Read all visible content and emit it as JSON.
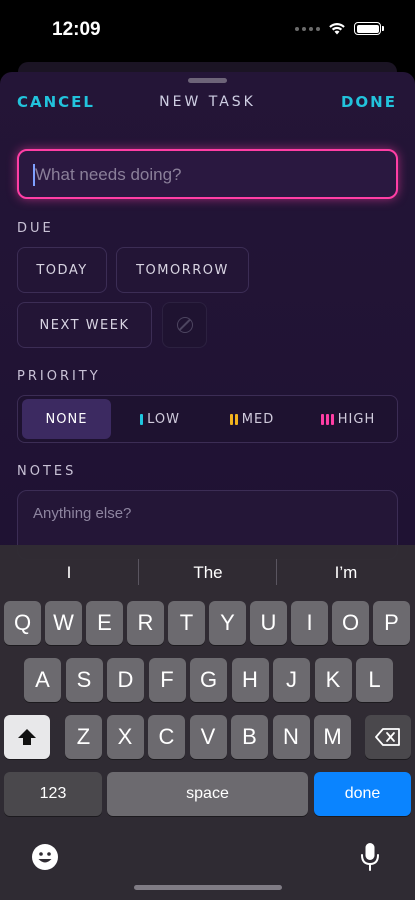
{
  "status_bar": {
    "time": "12:09"
  },
  "nav": {
    "cancel_label": "CANCEL",
    "title": "NEW TASK",
    "done_label": "DONE"
  },
  "task_input": {
    "placeholder": "What needs doing?",
    "value": ""
  },
  "due": {
    "label": "DUE",
    "options": [
      "TODAY",
      "TOMORROW",
      "NEXT WEEK"
    ],
    "clear_icon": "no-date-icon"
  },
  "priority": {
    "label": "PRIORITY",
    "options": [
      {
        "label": "NONE",
        "selected": true,
        "bar_count": 0,
        "color": ""
      },
      {
        "label": "LOW",
        "selected": false,
        "bar_count": 1,
        "color": "#1fc6e0"
      },
      {
        "label": "MED",
        "selected": false,
        "bar_count": 2,
        "color": "#f2b31f"
      },
      {
        "label": "HIGH",
        "selected": false,
        "bar_count": 3,
        "color": "#ff3ea5"
      }
    ]
  },
  "notes": {
    "label": "NOTES",
    "placeholder": "Anything else?"
  },
  "keyboard": {
    "suggestions": [
      "I",
      "The",
      "I’m"
    ],
    "row1": [
      "Q",
      "W",
      "E",
      "R",
      "T",
      "Y",
      "U",
      "I",
      "O",
      "P"
    ],
    "row2": [
      "A",
      "S",
      "D",
      "F",
      "G",
      "H",
      "J",
      "K",
      "L"
    ],
    "row3": [
      "Z",
      "X",
      "C",
      "V",
      "B",
      "N",
      "M"
    ],
    "numbers_label": "123",
    "space_label": "space",
    "done_label": "done"
  },
  "colors": {
    "accent": "#22c3dc",
    "focus": "#ff3ea5",
    "keyboard_done": "#0a84ff"
  }
}
